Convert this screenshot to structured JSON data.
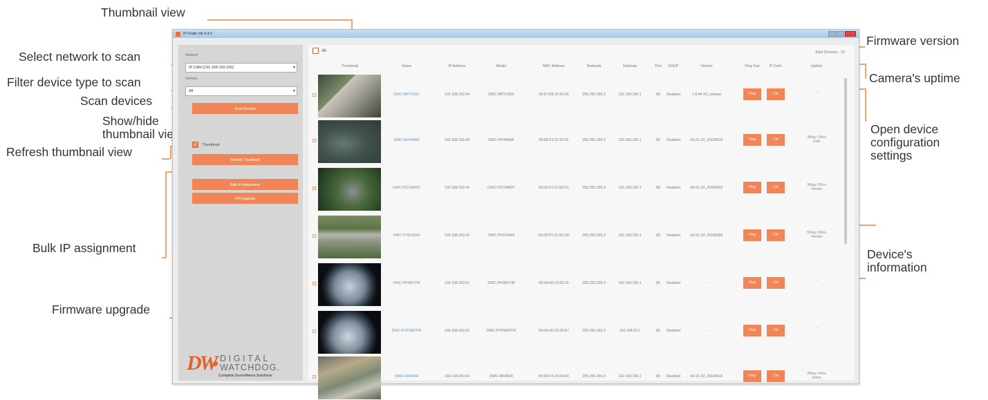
{
  "callouts": {
    "thumbnail_view": "Thumbnail view",
    "select_network": "Select network to scan",
    "filter_device": "Filter device type to scan",
    "scan_devices": "Scan devices",
    "show_hide_1": "Show/hide",
    "show_hide_2": "thumbnail view",
    "refresh_thumb": "Refresh thumbnail view",
    "bulk_ip": "Bulk IP assignment",
    "firmware_upgrade": "Firmware upgrade",
    "firmware_version": "Firmware version",
    "camera_uptime": "Camera's uptime",
    "open_config_1": "Open device",
    "open_config_2": "configuration",
    "open_config_3": "settings",
    "device_info_1": "Device's",
    "device_info_2": "information"
  },
  "window": {
    "title": "IP Finder  Ver 6.4.0"
  },
  "sidebar": {
    "network_label": "Network",
    "network_value": "IP CAM [192.168.150.150]",
    "devices_label": "Devices",
    "devices_value": "All",
    "scan_button": "Scan Devices",
    "thumbnail_label": "Thumbnail",
    "thumbnail_checked": true,
    "refresh_button": "Refresh Thumbnail",
    "bulk_button": "Bulk IP Assignment",
    "fw_button": "F/W Upgrade"
  },
  "logo": {
    "mark": "DW",
    "line1": "DIGITAL",
    "line2": "WATCHDOG.",
    "tagline": "Complete Surveillance Solutions",
    "brand_color": "#e0652d"
  },
  "main": {
    "all_label": "All",
    "total_devices": "Total Devices : 15",
    "headers": [
      "Thumbnail",
      "Name",
      "IP Address",
      "Model",
      "MAC Address",
      "Netmask",
      "Gateway",
      "Port",
      "DHCP",
      "Version",
      "Ping Test",
      "IP Conf.",
      "Uptime"
    ],
    "ping_label": "Ping",
    "conf_label": "Ctrl",
    "rows": [
      {
        "name": "DWC-MPTZ30X",
        "ip": "192.168.150.34",
        "model": "DWC-MPTZ30X",
        "mac": "00:07:D8:19:10:1A",
        "netmask": "255.255.255.0",
        "gateway": "192.168.150.1",
        "port": "80",
        "dhcp": "Disabled",
        "version": "1.8.44-X2_release",
        "uptime1": "- - -",
        "uptime2": ""
      },
      {
        "name": "DWC-MV44WiA",
        "ip": "192.168.150.40",
        "model": "DWC-MV44WiA",
        "mac": "00:0D:F1:21:53:0F",
        "netmask": "255.255.255.0",
        "gateway": "192.168.150.1",
        "port": "80",
        "dhcp": "Disabled",
        "version": "A2.01.02_20180619",
        "uptime1": "38day 14hrs",
        "uptime2": "1min"
      },
      {
        "name": "DWC-PZ21M69T",
        "ip": "192.168.150.41",
        "model": "DWC-PZ21M69T",
        "mac": "00:0D:F1:21:5D:21",
        "netmask": "255.255.255.0",
        "gateway": "192.168.150.1",
        "port": "80",
        "dhcp": "Disabled",
        "version": "A5.01.03_20180403",
        "uptime1": "38day 15hrs",
        "uptime2": "34mins"
      },
      {
        "name": "DWC-PVD16W4",
        "ip": "192.168.150.42",
        "model": "DWC-PVD16W4",
        "mac": "00:0D:F1:21:0C:6D",
        "netmask": "255.255.255.0",
        "gateway": "192.168.150.1",
        "port": "80",
        "dhcp": "Disabled",
        "version": "A2.01.03_20180309",
        "uptime1": "56day 18hrs",
        "uptime2": "44mins"
      },
      {
        "name": "DWC-PF5M1TIR",
        "ip": "192.168.150.61",
        "model": "DWC-PF5M1TIR",
        "mac": "00:0A:6D:19:00:15",
        "netmask": "255.255.255.0",
        "gateway": "192.168.150.1",
        "port": "80",
        "dhcp": "Disabled",
        "version": "--",
        "uptime1": "- - -",
        "uptime2": ""
      },
      {
        "name": "DWC-PVF9M2TIR",
        "ip": "192.168.150.62",
        "model": "DWC-PVF9M2TIR",
        "mac": "00:0A:6D:19:26:E7",
        "netmask": "255.255.255.0",
        "gateway": "192.168.50.1",
        "port": "80",
        "dhcp": "Disabled",
        "version": "--",
        "uptime1": "- - -",
        "uptime2": ""
      },
      {
        "name": "DWC-MF4Wi4",
        "ip": "192.168.150.63",
        "model": "DWC-MF4Wi4",
        "mac": "00:0D:F1:20:F8:93",
        "netmask": "255.255.255.0",
        "gateway": "192.168.150.1",
        "port": "80",
        "dhcp": "Disabled",
        "version": "A2.01.02_20180619",
        "uptime1": "28day 14hrs",
        "uptime2": "3mins"
      }
    ]
  },
  "colors": {
    "accent": "#f08657",
    "leader_line": "#f4a26b",
    "sidebar_bg": "#d6d6d6"
  }
}
